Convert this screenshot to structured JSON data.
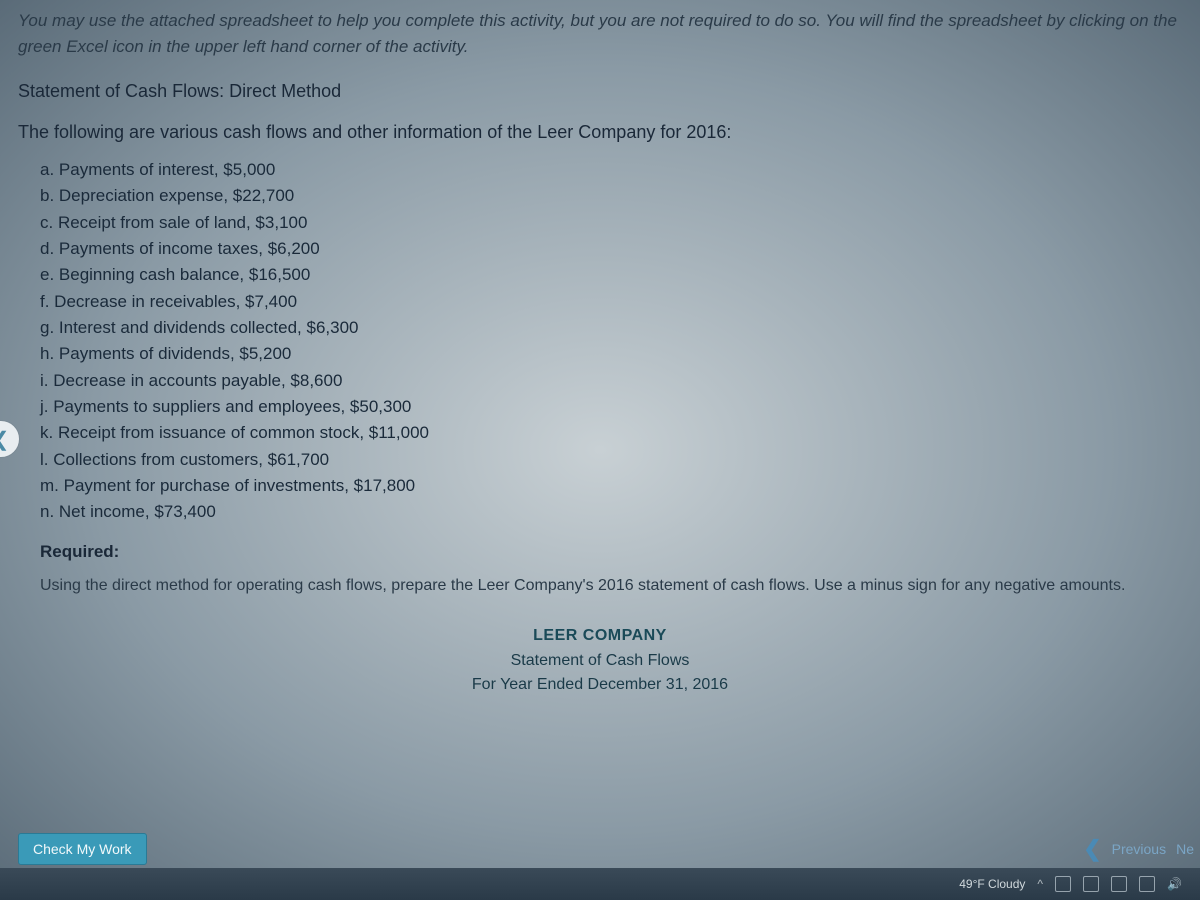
{
  "instruction": "You may use the attached spreadsheet to help you complete this activity, but you are not required to do so. You will find the spreadsheet by clicking on the green Excel icon in the upper left hand corner of the activity.",
  "section_title": "Statement of Cash Flows: Direct Method",
  "lead_text": "The following are various cash flows and other information of the Leer Company for 2016:",
  "items": [
    "a. Payments of interest, $5,000",
    "b. Depreciation expense, $22,700",
    "c. Receipt from sale of land, $3,100",
    "d. Payments of income taxes, $6,200",
    "e. Beginning cash balance, $16,500",
    "f. Decrease in receivables, $7,400",
    "g. Interest and dividends collected, $6,300",
    "h. Payments of dividends, $5,200",
    "i. Decrease in accounts payable, $8,600",
    "j. Payments to suppliers and employees, $50,300",
    "k. Receipt from issuance of common stock, $11,000",
    "l. Collections from customers, $61,700",
    "m. Payment for purchase of investments, $17,800",
    "n. Net income, $73,400"
  ],
  "required_title": "Required:",
  "required_text": "Using the direct method for operating cash flows, prepare the Leer Company's 2016 statement of cash flows. Use a minus sign for any negative amounts.",
  "statement": {
    "company": "LEER COMPANY",
    "title": "Statement of Cash Flows",
    "period": "For Year Ended December 31, 2016"
  },
  "buttons": {
    "check": "Check My Work",
    "previous": "Previous",
    "next": "Ne"
  },
  "taskbar": {
    "weather": "49°F Cloudy"
  }
}
